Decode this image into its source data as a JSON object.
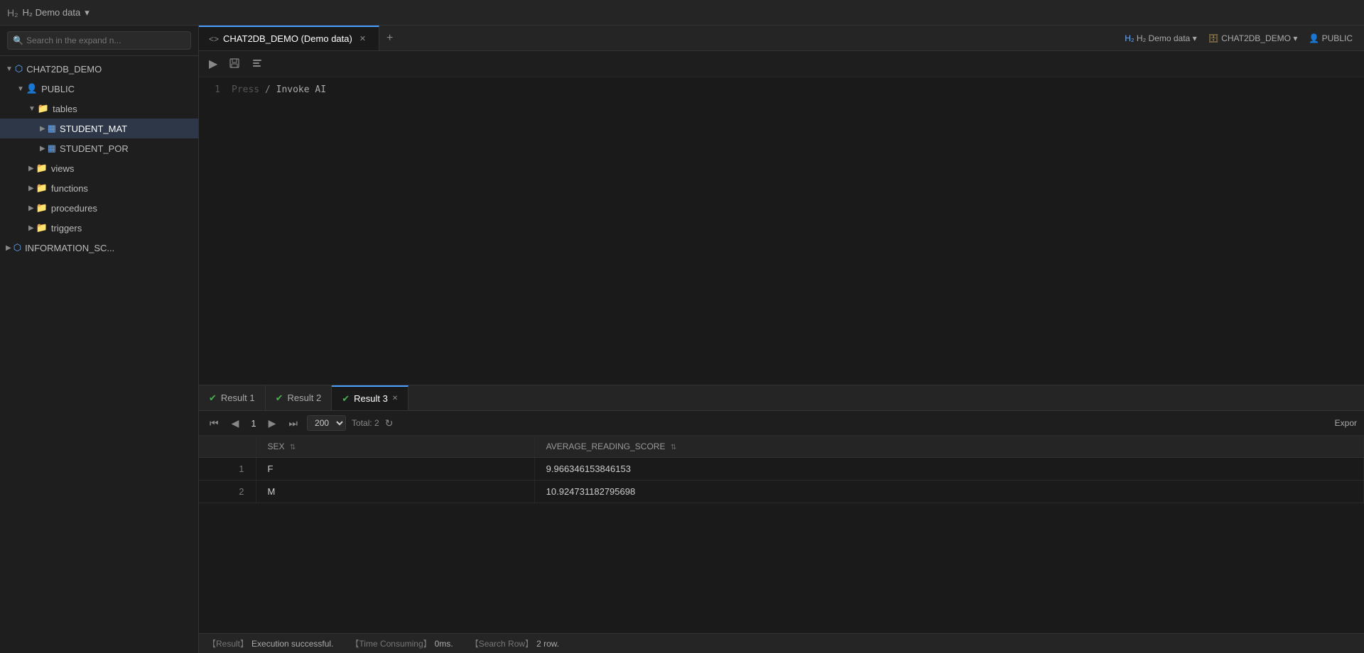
{
  "titleBar": {
    "leftLabel": "H₂ Demo data",
    "dropdownIcon": "▾"
  },
  "headerRight": {
    "db": "H₂ Demo data",
    "schema": "CHAT2DB_DEMO",
    "user": "PUBLIC"
  },
  "tabs": [
    {
      "id": "main",
      "icon": "<>",
      "label": "CHAT2DB_DEMO (Demo data)",
      "active": true,
      "closeable": true
    }
  ],
  "editor": {
    "lineNumbers": [
      "1"
    ],
    "placeholder": "Press",
    "slash": "/",
    "invokeText": "Invoke AI"
  },
  "toolbar": {
    "runBtn": "▶",
    "saveBtn": "💾",
    "formatBtn": "⊡"
  },
  "sidebar": {
    "searchPlaceholder": "Search in the expand n...",
    "tree": [
      {
        "level": 0,
        "icon": "▼",
        "nodeIcon": "🗄",
        "label": "CHAT2DB_DEMO",
        "expanded": true
      },
      {
        "level": 1,
        "icon": "▼",
        "nodeIcon": "👤",
        "label": "PUBLIC",
        "expanded": true
      },
      {
        "level": 2,
        "icon": "▼",
        "nodeIcon": "📁",
        "label": "tables",
        "expanded": true
      },
      {
        "level": 3,
        "icon": "▶",
        "nodeIcon": "⊞",
        "label": "STUDENT_MAT",
        "selected": true
      },
      {
        "level": 3,
        "icon": "▶",
        "nodeIcon": "⊞",
        "label": "STUDENT_POR",
        "selected": false
      },
      {
        "level": 2,
        "icon": "▶",
        "nodeIcon": "📁",
        "label": "views",
        "expanded": false
      },
      {
        "level": 2,
        "icon": "▶",
        "nodeIcon": "📁",
        "label": "functions",
        "expanded": false
      },
      {
        "level": 2,
        "icon": "▶",
        "nodeIcon": "📁",
        "label": "procedures",
        "expanded": false
      },
      {
        "level": 2,
        "icon": "▶",
        "nodeIcon": "📁",
        "label": "triggers",
        "expanded": false
      },
      {
        "level": 0,
        "icon": "▶",
        "nodeIcon": "🗄",
        "label": "INFORMATION_SC...",
        "expanded": false
      }
    ]
  },
  "resultTabs": [
    {
      "id": "r1",
      "label": "Result 1",
      "active": false,
      "closeable": false
    },
    {
      "id": "r2",
      "label": "Result 2",
      "active": false,
      "closeable": false
    },
    {
      "id": "r3",
      "label": "Result 3",
      "active": true,
      "closeable": true
    }
  ],
  "pagination": {
    "currentPage": "1",
    "pageSize": "200",
    "totalLabel": "Total:",
    "totalCount": "2",
    "refreshIcon": "↻"
  },
  "table": {
    "columns": [
      {
        "id": "rownum",
        "label": "",
        "sortable": false
      },
      {
        "id": "sex",
        "label": "SEX",
        "sortable": true
      },
      {
        "id": "avg_score",
        "label": "AVERAGE_READING_SCORE",
        "sortable": true
      }
    ],
    "rows": [
      {
        "rownum": "1",
        "sex": "F",
        "avg_score": "9.9663461538461​53"
      },
      {
        "rownum": "2",
        "sex": "M",
        "avg_score": "10.924731182795698"
      }
    ]
  },
  "statusBar": {
    "resultLabel": "【Result】",
    "resultValue": "Execution successful.",
    "timeLabel": "【Time Consuming】",
    "timeValue": "0ms.",
    "searchRowLabel": "【Search Row】",
    "searchRowValue": "2 row."
  },
  "export": {
    "label": "Expor"
  }
}
